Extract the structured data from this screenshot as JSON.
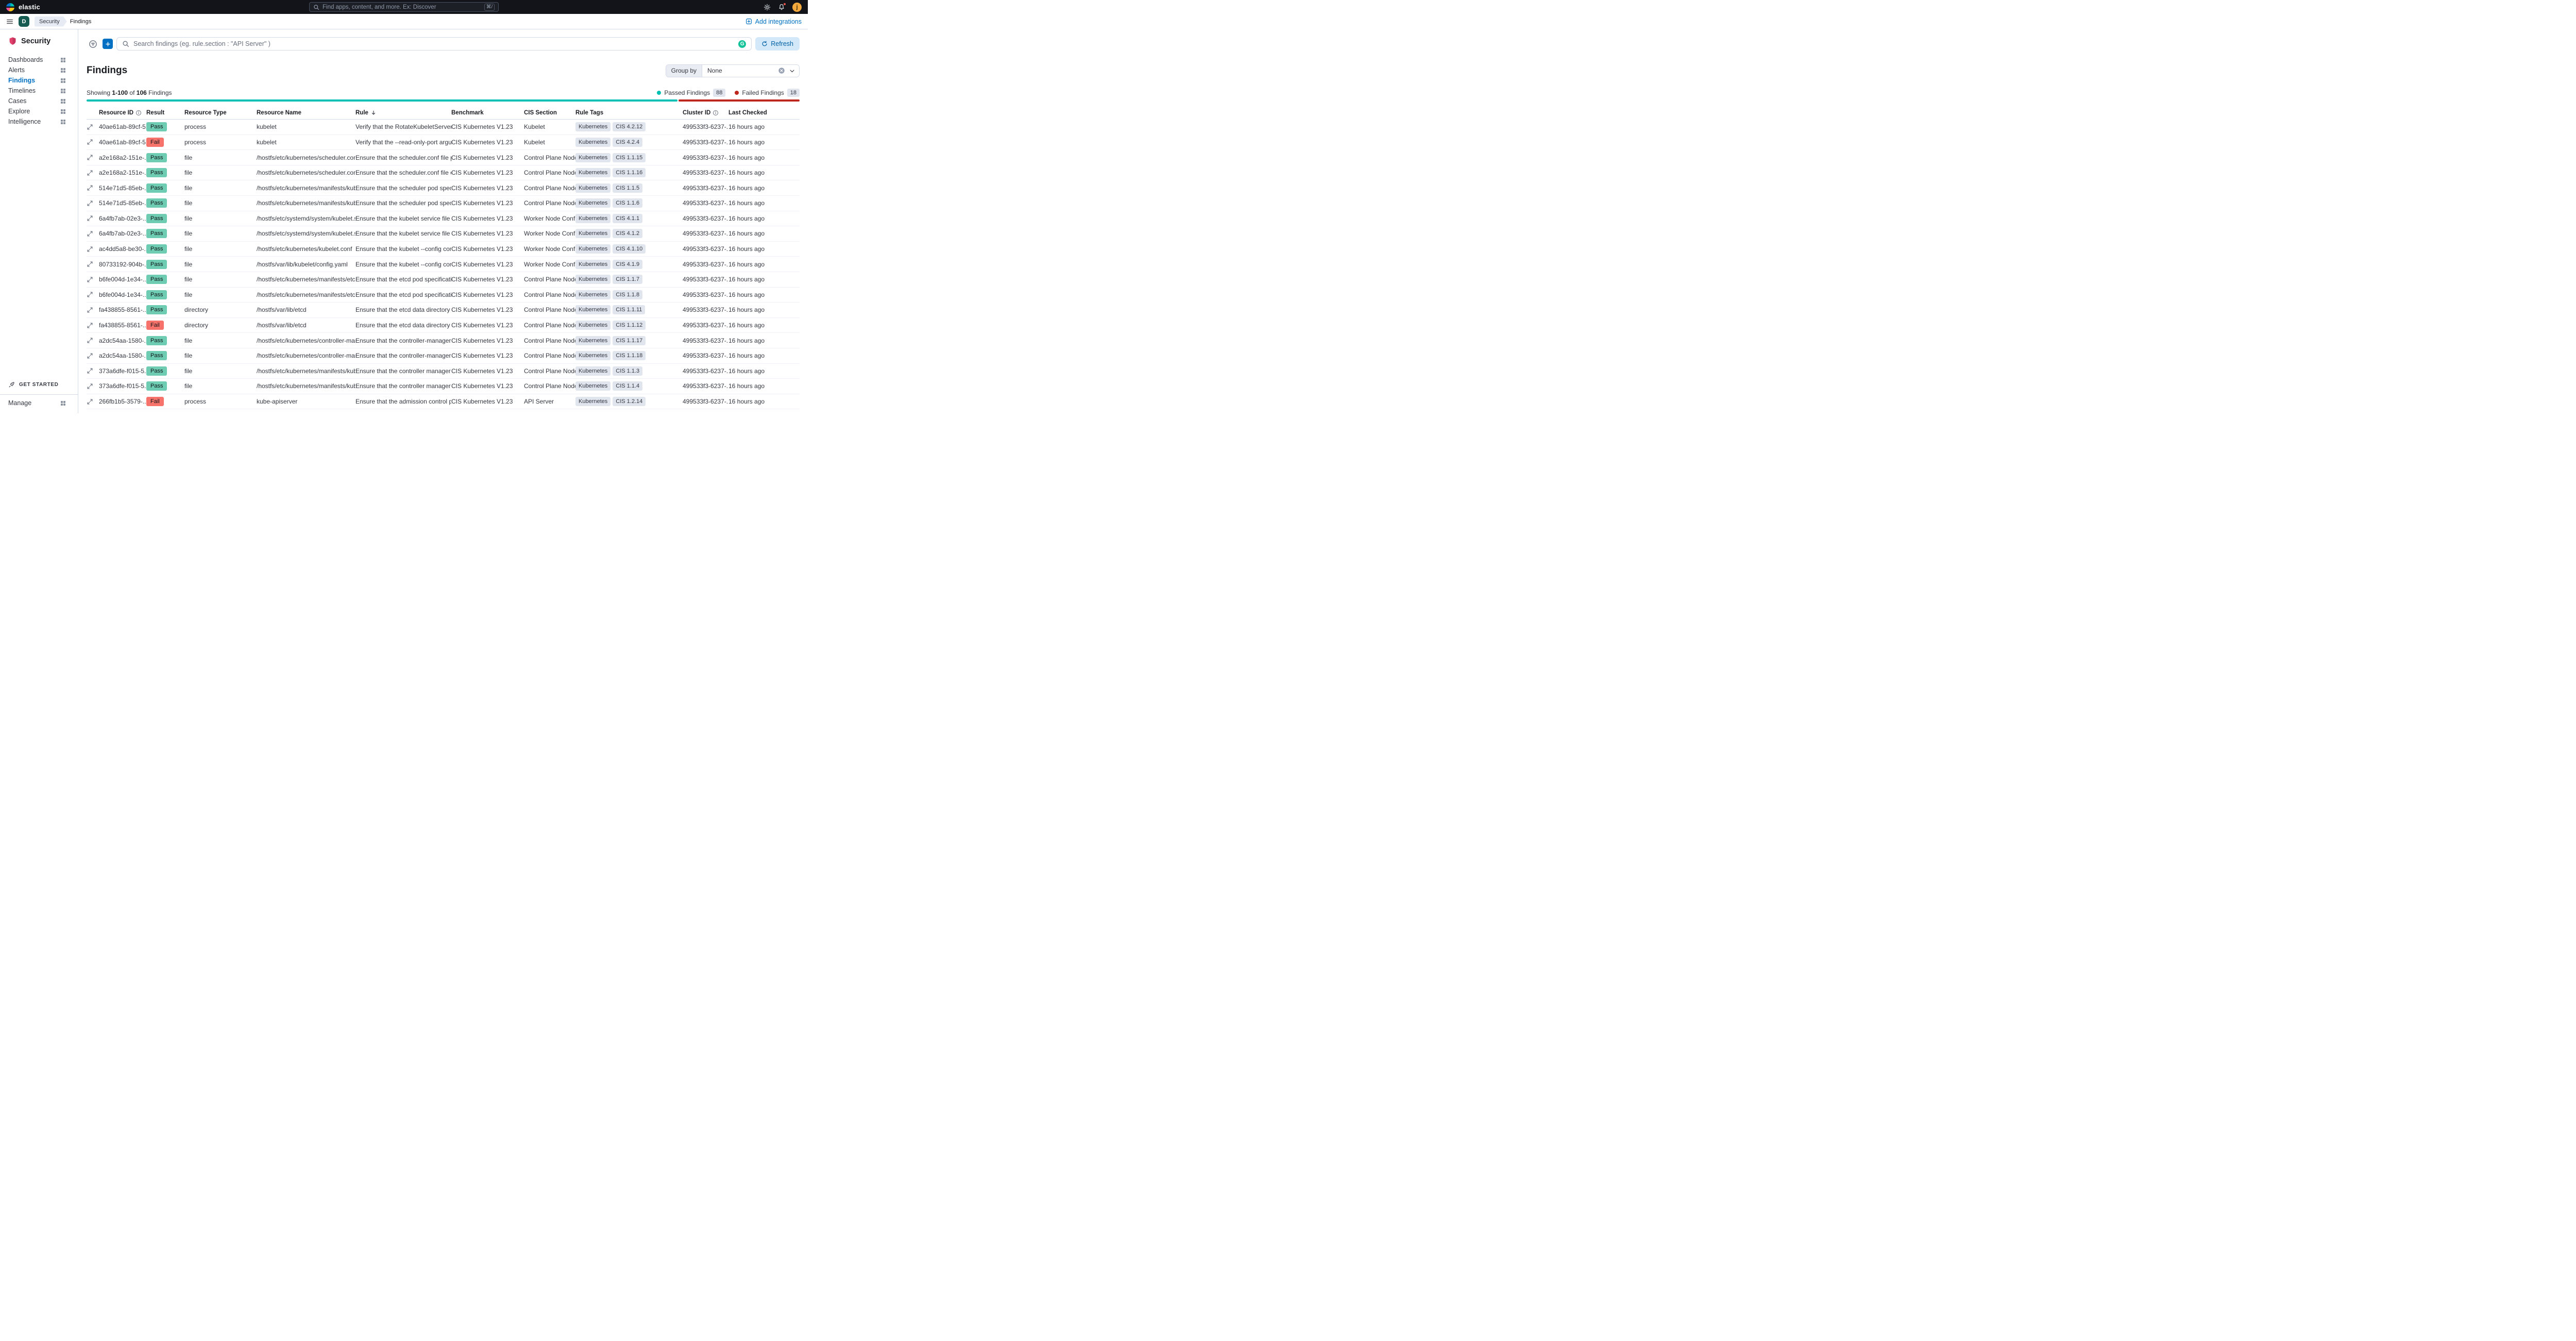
{
  "topbar": {
    "brand": "elastic",
    "search_placeholder": "Find apps, content, and more. Ex: Discover",
    "search_shortcut": "⌘/",
    "avatar_letter": "j"
  },
  "navbar": {
    "space_initial": "D",
    "breadcrumb_root": "Security",
    "breadcrumb_current": "Findings",
    "add_integrations_label": "Add integrations"
  },
  "sidebar": {
    "title": "Security",
    "items": [
      {
        "label": "Dashboards",
        "grid": true
      },
      {
        "label": "Alerts"
      },
      {
        "label": "Findings",
        "active": true
      },
      {
        "label": "Timelines"
      },
      {
        "label": "Cases"
      },
      {
        "label": "Explore",
        "grid": true
      },
      {
        "label": "Intelligence"
      }
    ],
    "get_started_label": "GET STARTED",
    "manage_label": "Manage"
  },
  "toolbar": {
    "search_placeholder": "Search findings (eg. rule.section : \"API Server\" )",
    "refresh_label": "Refresh"
  },
  "findings_header": {
    "title": "Findings",
    "group_by_label": "Group by",
    "group_by_value": "None",
    "showing": {
      "prefix": "Showing",
      "range": "1-100",
      "of": "of",
      "total": "106",
      "suffix": "Findings"
    },
    "legend": {
      "passed_label": "Passed Findings",
      "passed_count": "88",
      "failed_label": "Failed Findings",
      "failed_count": "18"
    },
    "distribution": {
      "passed": 88,
      "failed": 18
    }
  },
  "table": {
    "headers": [
      {
        "label": "Resource ID",
        "info": true
      },
      {
        "label": "Result"
      },
      {
        "label": "Resource Type"
      },
      {
        "label": "Resource Name"
      },
      {
        "label": "Rule",
        "sorted": "desc"
      },
      {
        "label": "Benchmark"
      },
      {
        "label": "CIS Section"
      },
      {
        "label": "Rule Tags"
      },
      {
        "label": "Cluster ID",
        "info": true
      },
      {
        "label": "Last Checked"
      }
    ],
    "rows": [
      {
        "id": "40ae61ab-89cf-5...",
        "result": "Pass",
        "type": "process",
        "name": "kubelet",
        "rule": "Verify that the RotateKubeletServerCertifi...",
        "benchmark": "CIS Kubernetes V1.23",
        "section": "Kubelet",
        "tags": [
          "Kubernetes",
          "CIS 4.2.12"
        ],
        "cluster": "499533f3-6237-...",
        "checked": "16 hours ago"
      },
      {
        "id": "40ae61ab-89cf-5...",
        "result": "Fail",
        "type": "process",
        "name": "kubelet",
        "rule": "Verify that the --read-only-port argument ...",
        "benchmark": "CIS Kubernetes V1.23",
        "section": "Kubelet",
        "tags": [
          "Kubernetes",
          "CIS 4.2.4"
        ],
        "cluster": "499533f3-6237-...",
        "checked": "16 hours ago"
      },
      {
        "id": "a2e168a2-151e-...",
        "result": "Pass",
        "type": "file",
        "name": "/hostfs/etc/kubernetes/scheduler.conf",
        "rule": "Ensure that the scheduler.conf file permis...",
        "benchmark": "CIS Kubernetes V1.23",
        "section": "Control Plane Node...",
        "tags": [
          "Kubernetes",
          "CIS 1.1.15"
        ],
        "cluster": "499533f3-6237-...",
        "checked": "16 hours ago"
      },
      {
        "id": "a2e168a2-151e-...",
        "result": "Pass",
        "type": "file",
        "name": "/hostfs/etc/kubernetes/scheduler.conf",
        "rule": "Ensure that the scheduler.conf file owners...",
        "benchmark": "CIS Kubernetes V1.23",
        "section": "Control Plane Node...",
        "tags": [
          "Kubernetes",
          "CIS 1.1.16"
        ],
        "cluster": "499533f3-6237-...",
        "checked": "16 hours ago"
      },
      {
        "id": "514e71d5-85eb-...",
        "result": "Pass",
        "type": "file",
        "name": "/hostfs/etc/kubernetes/manifests/kube-sc...",
        "rule": "Ensure that the scheduler pod specificatio...",
        "benchmark": "CIS Kubernetes V1.23",
        "section": "Control Plane Node...",
        "tags": [
          "Kubernetes",
          "CIS 1.1.5"
        ],
        "cluster": "499533f3-6237-...",
        "checked": "16 hours ago"
      },
      {
        "id": "514e71d5-85eb-...",
        "result": "Pass",
        "type": "file",
        "name": "/hostfs/etc/kubernetes/manifests/kube-sc...",
        "rule": "Ensure that the scheduler pod specificatio...",
        "benchmark": "CIS Kubernetes V1.23",
        "section": "Control Plane Node...",
        "tags": [
          "Kubernetes",
          "CIS 1.1.6"
        ],
        "cluster": "499533f3-6237-...",
        "checked": "16 hours ago"
      },
      {
        "id": "6a4fb7ab-02e3-...",
        "result": "Pass",
        "type": "file",
        "name": "/hostfs/etc/systemd/system/kubelet.servi...",
        "rule": "Ensure that the kubelet service file permis...",
        "benchmark": "CIS Kubernetes V1.23",
        "section": "Worker Node Confi...",
        "tags": [
          "Kubernetes",
          "CIS 4.1.1"
        ],
        "cluster": "499533f3-6237-...",
        "checked": "16 hours ago"
      },
      {
        "id": "6a4fb7ab-02e3-...",
        "result": "Pass",
        "type": "file",
        "name": "/hostfs/etc/systemd/system/kubelet.servi...",
        "rule": "Ensure that the kubelet service file owner...",
        "benchmark": "CIS Kubernetes V1.23",
        "section": "Worker Node Confi...",
        "tags": [
          "Kubernetes",
          "CIS 4.1.2"
        ],
        "cluster": "499533f3-6237-...",
        "checked": "16 hours ago"
      },
      {
        "id": "ac4dd5a8-be30-...",
        "result": "Pass",
        "type": "file",
        "name": "/hostfs/etc/kubernetes/kubelet.conf",
        "rule": "Ensure that the kubelet --config configura...",
        "benchmark": "CIS Kubernetes V1.23",
        "section": "Worker Node Confi...",
        "tags": [
          "Kubernetes",
          "CIS 4.1.10"
        ],
        "cluster": "499533f3-6237-...",
        "checked": "16 hours ago"
      },
      {
        "id": "80733192-904b-...",
        "result": "Pass",
        "type": "file",
        "name": "/hostfs/var/lib/kubelet/config.yaml",
        "rule": "Ensure that the kubelet --config configura...",
        "benchmark": "CIS Kubernetes V1.23",
        "section": "Worker Node Confi...",
        "tags": [
          "Kubernetes",
          "CIS 4.1.9"
        ],
        "cluster": "499533f3-6237-...",
        "checked": "16 hours ago"
      },
      {
        "id": "b6fe004d-1e34-...",
        "result": "Pass",
        "type": "file",
        "name": "/hostfs/etc/kubernetes/manifests/etcd.yaml",
        "rule": "Ensure that the etcd pod specification file ...",
        "benchmark": "CIS Kubernetes V1.23",
        "section": "Control Plane Node...",
        "tags": [
          "Kubernetes",
          "CIS 1.1.7"
        ],
        "cluster": "499533f3-6237-...",
        "checked": "16 hours ago"
      },
      {
        "id": "b6fe004d-1e34-...",
        "result": "Pass",
        "type": "file",
        "name": "/hostfs/etc/kubernetes/manifests/etcd.yaml",
        "rule": "Ensure that the etcd pod specification file ...",
        "benchmark": "CIS Kubernetes V1.23",
        "section": "Control Plane Node...",
        "tags": [
          "Kubernetes",
          "CIS 1.1.8"
        ],
        "cluster": "499533f3-6237-...",
        "checked": "16 hours ago"
      },
      {
        "id": "fa438855-8561-...",
        "result": "Pass",
        "type": "directory",
        "name": "/hostfs/var/lib/etcd",
        "rule": "Ensure that the etcd data directory permis...",
        "benchmark": "CIS Kubernetes V1.23",
        "section": "Control Plane Node...",
        "tags": [
          "Kubernetes",
          "CIS 1.1.11"
        ],
        "cluster": "499533f3-6237-...",
        "checked": "16 hours ago"
      },
      {
        "id": "fa438855-8561-...",
        "result": "Fail",
        "type": "directory",
        "name": "/hostfs/var/lib/etcd",
        "rule": "Ensure that the etcd data directory owner...",
        "benchmark": "CIS Kubernetes V1.23",
        "section": "Control Plane Node...",
        "tags": [
          "Kubernetes",
          "CIS 1.1.12"
        ],
        "cluster": "499533f3-6237-...",
        "checked": "16 hours ago"
      },
      {
        "id": "a2dc54aa-1580-...",
        "result": "Pass",
        "type": "file",
        "name": "/hostfs/etc/kubernetes/controller-manage...",
        "rule": "Ensure that the controller-manager.conf fil...",
        "benchmark": "CIS Kubernetes V1.23",
        "section": "Control Plane Node...",
        "tags": [
          "Kubernetes",
          "CIS 1.1.17"
        ],
        "cluster": "499533f3-6237-...",
        "checked": "16 hours ago"
      },
      {
        "id": "a2dc54aa-1580-...",
        "result": "Pass",
        "type": "file",
        "name": "/hostfs/etc/kubernetes/controller-manage...",
        "rule": "Ensure that the controller-manager.conf fil...",
        "benchmark": "CIS Kubernetes V1.23",
        "section": "Control Plane Node...",
        "tags": [
          "Kubernetes",
          "CIS 1.1.18"
        ],
        "cluster": "499533f3-6237-...",
        "checked": "16 hours ago"
      },
      {
        "id": "373a6dfe-f015-5...",
        "result": "Pass",
        "type": "file",
        "name": "/hostfs/etc/kubernetes/manifests/kube-co...",
        "rule": "Ensure that the controller manager pod sp...",
        "benchmark": "CIS Kubernetes V1.23",
        "section": "Control Plane Node...",
        "tags": [
          "Kubernetes",
          "CIS 1.1.3"
        ],
        "cluster": "499533f3-6237-...",
        "checked": "16 hours ago"
      },
      {
        "id": "373a6dfe-f015-5...",
        "result": "Pass",
        "type": "file",
        "name": "/hostfs/etc/kubernetes/manifests/kube-co...",
        "rule": "Ensure that the controller manager pod sp...",
        "benchmark": "CIS Kubernetes V1.23",
        "section": "Control Plane Node...",
        "tags": [
          "Kubernetes",
          "CIS 1.1.4"
        ],
        "cluster": "499533f3-6237-...",
        "checked": "16 hours ago"
      },
      {
        "id": "266fb1b5-3579-...",
        "result": "Fail",
        "type": "process",
        "name": "kube-apiserver",
        "rule": "Ensure that the admission control plugin S...",
        "benchmark": "CIS Kubernetes V1.23",
        "section": "API Server",
        "tags": [
          "Kubernetes",
          "CIS 1.2.14"
        ],
        "cluster": "499533f3-6237-...",
        "checked": "16 hours ago"
      }
    ]
  },
  "colors": {
    "accent_primary": "#0071c2",
    "pass_bg": "#6dccb1",
    "fail_bg": "#f6726b",
    "passed_bar": "#00bfb3",
    "failed_bar": "#bd271e",
    "tag_bg": "#e0e5ee",
    "space_badge_bg": "#155b52",
    "avatar_bg": "#f3a93c"
  }
}
